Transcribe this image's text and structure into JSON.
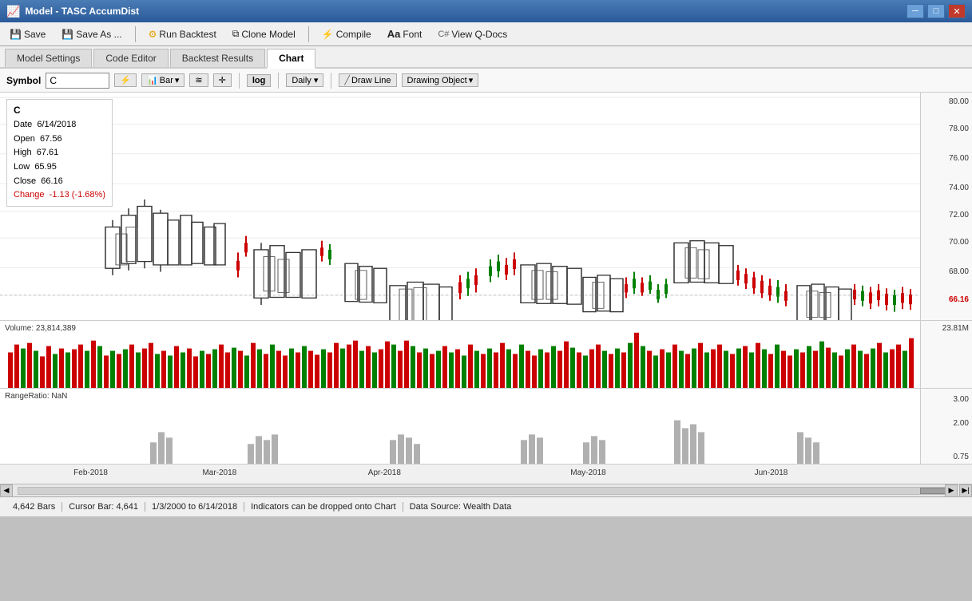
{
  "window": {
    "title": "Model - TASC AccumDist"
  },
  "toolbar": {
    "save_label": "Save",
    "saveas_label": "Save As ...",
    "runbacktest_label": "Run Backtest",
    "clonemodel_label": "Clone Model",
    "compile_label": "Compile",
    "font_label": "Font",
    "viewqdocs_label": "View Q-Docs"
  },
  "tabs": [
    {
      "label": "Model Settings",
      "active": false
    },
    {
      "label": "Code Editor",
      "active": false
    },
    {
      "label": "Backtest Results",
      "active": false
    },
    {
      "label": "Chart",
      "active": true
    }
  ],
  "chart_toolbar": {
    "symbol_label": "Symbol",
    "symbol_value": "C",
    "bar_label": "Bar",
    "draw_line_label": "Draw Line",
    "drawing_object_label": "Drawing Object",
    "log_label": "log",
    "daily_label": "Daily"
  },
  "ohlc": {
    "symbol": "C",
    "date_label": "Date",
    "date_value": "6/14/2018",
    "open_label": "Open",
    "open_value": "67.56",
    "high_label": "High",
    "high_value": "67.61",
    "low_label": "Low",
    "low_value": "65.95",
    "close_label": "Close",
    "close_value": "66.16",
    "change_label": "Change",
    "change_value": "-1.13 (-1.68%)"
  },
  "price_scale": {
    "levels": [
      {
        "value": "80.00",
        "pct": 2
      },
      {
        "value": "78.00",
        "pct": 14
      },
      {
        "value": "76.00",
        "pct": 27
      },
      {
        "value": "74.00",
        "pct": 40
      },
      {
        "value": "72.00",
        "pct": 52
      },
      {
        "value": "70.00",
        "pct": 64
      },
      {
        "value": "68.00",
        "pct": 77
      },
      {
        "value": "66.16",
        "pct": 89
      }
    ]
  },
  "volume": {
    "label": "Volume: 23,814,389",
    "scale_top": "23.81M"
  },
  "indicator": {
    "label": "RangeRatio: NaN",
    "scale_levels": [
      {
        "value": "3.00",
        "pct": 8
      },
      {
        "value": "2.00",
        "pct": 40
      },
      {
        "value": "0.75",
        "pct": 85
      }
    ]
  },
  "time_labels": [
    {
      "label": "Feb-2018",
      "pct": 8
    },
    {
      "label": "Mar-2018",
      "pct": 22
    },
    {
      "label": "Apr-2018",
      "pct": 40
    },
    {
      "label": "May-2018",
      "pct": 62
    },
    {
      "label": "Jun-2018",
      "pct": 82
    }
  ],
  "statusbar": {
    "bars": "4,642 Bars",
    "cursor": "Cursor Bar: 4,641",
    "daterange": "1/3/2000 to 6/14/2018",
    "hint": "Indicators can be dropped onto Chart",
    "datasource": "Data Source: Wealth Data"
  },
  "colors": {
    "up": "#008000",
    "down": "#cc0000",
    "accent": "#2a5a9a"
  }
}
